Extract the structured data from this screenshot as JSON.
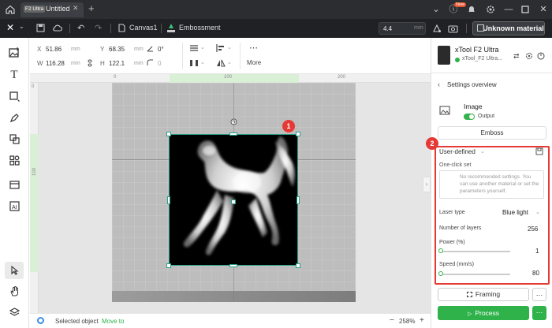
{
  "titlebar": {
    "badge": "F2 Ultra",
    "tab_title": "Untitled",
    "close_glyph": "✕",
    "plus_glyph": "+",
    "new_badge": "New",
    "icons": [
      "home-icon",
      "chevron-down-icon",
      "help-icon",
      "bell-icon",
      "settings-icon",
      "minimize-icon",
      "maximize-icon",
      "close-icon"
    ]
  },
  "toolbar": {
    "canvas_label": "Canvas1",
    "mode_label": "Embossment",
    "height_value": "4.4",
    "height_unit": "mm",
    "material_label": "Unknown material"
  },
  "propbar": {
    "x_label": "X",
    "x_value": "51.86",
    "x_unit": "mm",
    "w_label": "W",
    "w_value": "116.28",
    "w_unit": "mm",
    "y_label": "Y",
    "y_value": "68.35",
    "y_unit": "mm",
    "h_label": "H",
    "h_value": "122.1",
    "h_unit": "mm",
    "rotate_value": "0°",
    "corner_value": "0",
    "more_label": "More"
  },
  "rulers": {
    "top_ticks": [
      "0",
      "100",
      "200"
    ],
    "left_ticks": [
      "0",
      "100"
    ]
  },
  "canvas": {
    "badge1": "1",
    "badge2": "2"
  },
  "statusbar": {
    "selected_label": "Selected object",
    "move_link": "Move to",
    "minus": "−",
    "zoom": "258%",
    "plus": "+"
  },
  "rpanel": {
    "device_name": "xTool F2 Ultra",
    "device_sub": "xTool_F2 Ultra...",
    "settings_title": "Settings overview",
    "image_label": "Image",
    "output_label": "Output",
    "emboss_button": "Emboss",
    "preset": "User-defined",
    "oneclick_label": "One-click set",
    "oneclick_msg": "No recommended settings. You can use another material or set the parameters yourself.",
    "laser_type_label": "Laser type",
    "laser_type_value": "Blue light",
    "layers_label": "Number of layers",
    "layers_value": "256",
    "power_label": "Power (%)",
    "power_value": "1",
    "speed_label": "Speed (mm/s)",
    "speed_value": "80",
    "framing_button": "Framing",
    "process_button": "Process",
    "more_glyph": "…"
  },
  "colors": {
    "accent_green": "#2fb24a",
    "highlight_red": "#e53935",
    "selection_teal": "#2aa08a"
  }
}
